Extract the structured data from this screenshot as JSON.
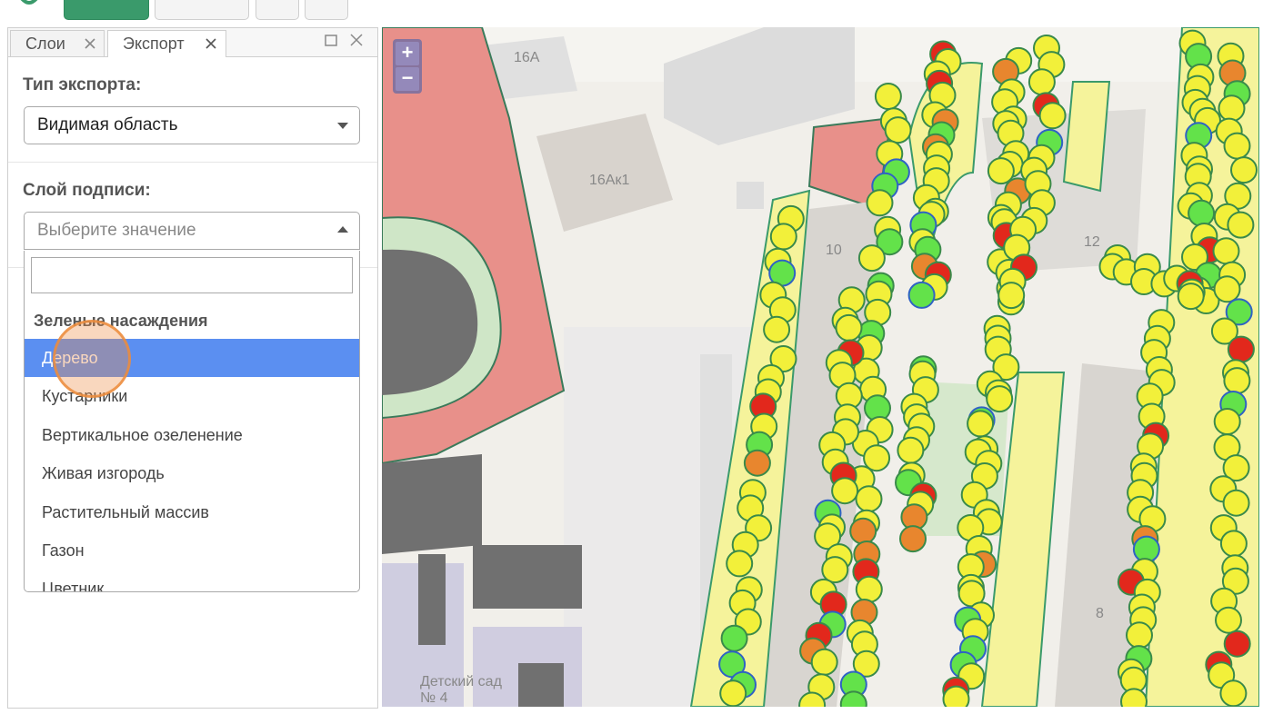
{
  "tabs": [
    {
      "label": "Слои"
    },
    {
      "label": "Экспорт"
    }
  ],
  "export": {
    "type_label": "Тип экспорта:",
    "type_value": "Видимая область",
    "caption_label": "Слой подписи:",
    "caption_placeholder": "Выберите значение"
  },
  "dropdown": {
    "group": "Зеленые насаждения",
    "items": [
      {
        "label": "Дерево"
      },
      {
        "label": "Кустарники"
      },
      {
        "label": "Вертикальное озеленение"
      },
      {
        "label": "Живая изгородь"
      },
      {
        "label": "Растительный массив"
      },
      {
        "label": "Газон"
      },
      {
        "label": "Цветник"
      }
    ]
  },
  "map": {
    "zoom_in": "+",
    "zoom_out": "−",
    "labels": [
      "16А",
      "16Ак1",
      "10",
      "12",
      "8",
      "Детский сад № 4"
    ],
    "point_colors": {
      "yellow": "#f2f03a",
      "green": "#63e24a",
      "red": "#e2281c",
      "orange": "#e8862e",
      "blue_stroke": "#2f62c4"
    }
  }
}
